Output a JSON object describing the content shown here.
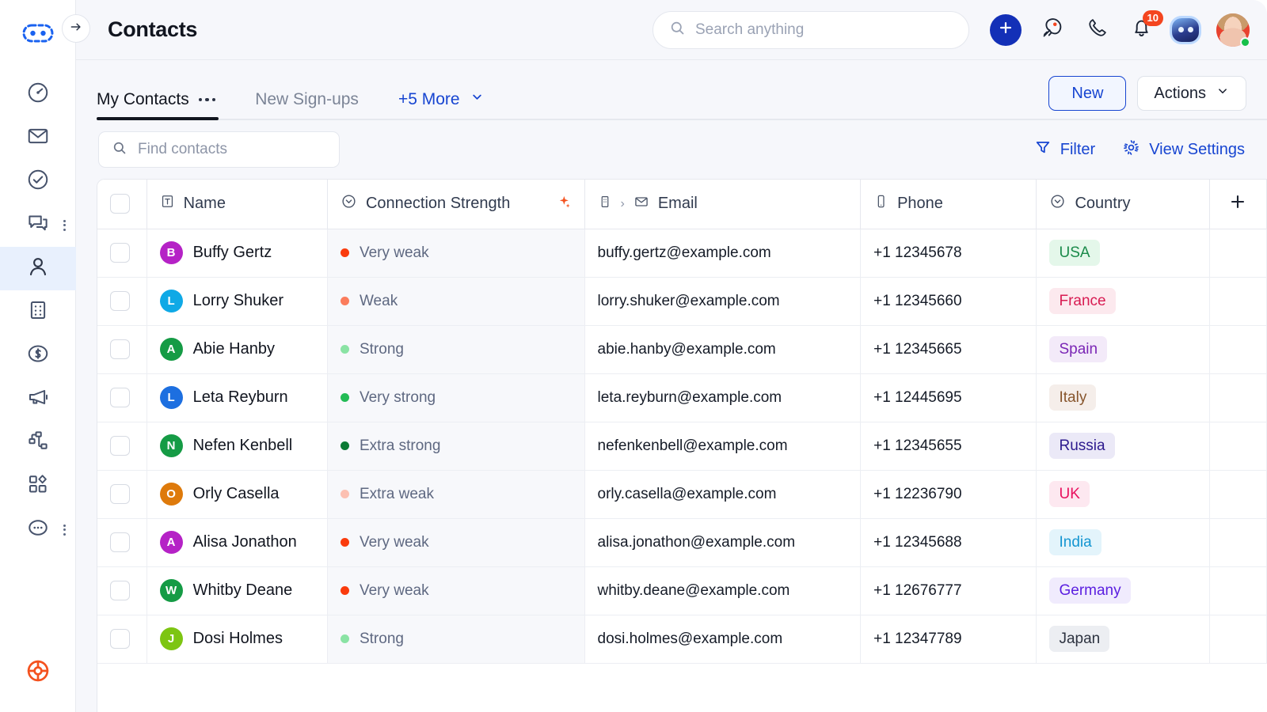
{
  "app": {
    "page_title": "Contacts",
    "collapse_icon": "arrow-right-icon",
    "logo_icon": "brand-logo-icon",
    "help_icon": "life-ring-icon"
  },
  "sidebar": {
    "items": [
      {
        "name": "dashboard",
        "icon": "gauge-icon",
        "active": false,
        "kebab": false
      },
      {
        "name": "mail",
        "icon": "envelope-icon",
        "active": false,
        "kebab": false
      },
      {
        "name": "tasks",
        "icon": "check-circle-icon",
        "active": false,
        "kebab": false
      },
      {
        "name": "chats",
        "icon": "chat-bubbles-icon",
        "active": false,
        "kebab": true
      },
      {
        "name": "contacts",
        "icon": "person-icon",
        "active": true,
        "kebab": false
      },
      {
        "name": "companies",
        "icon": "building-icon",
        "active": false,
        "kebab": false
      },
      {
        "name": "deals",
        "icon": "dollar-circle-icon",
        "active": false,
        "kebab": false
      },
      {
        "name": "marketing",
        "icon": "megaphone-icon",
        "active": false,
        "kebab": false
      },
      {
        "name": "workflows",
        "icon": "org-chart-icon",
        "active": false,
        "kebab": false
      },
      {
        "name": "apps",
        "icon": "apps-grid-icon",
        "active": false,
        "kebab": false
      },
      {
        "name": "more",
        "icon": "more-circle-icon",
        "active": false,
        "kebab": true
      }
    ]
  },
  "search": {
    "placeholder": "Search anything",
    "icon": "search-icon"
  },
  "topbar": {
    "add_label": "+",
    "add_icon": "plus-icon",
    "rocket_icon": "rocket-icon",
    "phone_icon": "phone-icon",
    "bell_icon": "bell-icon",
    "notification_count": "10",
    "bot_icon": "bot-icon",
    "avatar_icon": "user-avatar",
    "status": "online"
  },
  "tabs": {
    "items": [
      {
        "label": "My Contacts",
        "active": true,
        "has_dots": true
      },
      {
        "label": "New Sign-ups",
        "active": false,
        "has_dots": false
      }
    ],
    "more_label": "+5 More",
    "more_icon": "chevron-down-icon",
    "new_button": "New",
    "actions_button": "Actions",
    "actions_icon": "chevron-down-icon"
  },
  "toolbar": {
    "find_placeholder": "Find contacts",
    "find_icon": "search-icon",
    "filter_label": "Filter",
    "filter_icon": "funnel-icon",
    "view_settings_label": "View Settings",
    "view_settings_icon": "gear-icon"
  },
  "table": {
    "columns": [
      {
        "key": "check",
        "label": "",
        "icon": "checkbox-icon"
      },
      {
        "key": "name",
        "label": "Name",
        "icon": "text-type-icon"
      },
      {
        "key": "connection",
        "label": "Connection Strength",
        "icon": "chevron-down-circle-icon",
        "trailing_icon": "sparkle-icon"
      },
      {
        "key": "email",
        "label": "Email",
        "icon": "building-small-icon",
        "sub_icon": "envelope-small-icon",
        "separator": "›"
      },
      {
        "key": "phone",
        "label": "Phone",
        "icon": "mobile-icon"
      },
      {
        "key": "country",
        "label": "Country",
        "icon": "chevron-down-circle-icon"
      },
      {
        "key": "add",
        "label": "",
        "icon": "plus-icon"
      }
    ],
    "rows": [
      {
        "initial": "B",
        "avatar_color": "#b522c6",
        "name": "Buffy Gertz",
        "strength": "Very weak",
        "strength_color": "#fa3b0d",
        "email": "buffy.gertz@example.com",
        "phone": "+1 12345678",
        "country": "USA",
        "country_fg": "#1a8a4a",
        "country_bg": "#e4f7ea"
      },
      {
        "initial": "L",
        "avatar_color": "#0fa9e6",
        "name": "Lorry Shuker",
        "strength": "Weak",
        "strength_color": "#fb7c5c",
        "email": "lorry.shuker@example.com",
        "phone": "+1 12345660",
        "country": "France",
        "country_fg": "#d81b52",
        "country_bg": "#fce9ee"
      },
      {
        "initial": "A",
        "avatar_color": "#159b45",
        "name": "Abie Hanby",
        "strength": "Strong",
        "strength_color": "#8ae3a4",
        "email": "abie.hanby@example.com",
        "phone": "+1 12345665",
        "country": "Spain",
        "country_fg": "#7a25b5",
        "country_bg": "#f3eaf9"
      },
      {
        "initial": "L",
        "avatar_color": "#1d6fe0",
        "name": "Leta Reyburn",
        "strength": "Very strong",
        "strength_color": "#23bb55",
        "email": "leta.reyburn@example.com",
        "phone": "+1 12445695",
        "country": "Italy",
        "country_fg": "#87552c",
        "country_bg": "#f5eeea"
      },
      {
        "initial": "N",
        "avatar_color": "#159b45",
        "name": "Nefen Kenbell",
        "strength": "Extra strong",
        "strength_color": "#0b7a34",
        "email": "nefenkenbell@example.com",
        "phone": "+1 12345655",
        "country": "Russia",
        "country_fg": "#2d1a8e",
        "country_bg": "#ebe9f7"
      },
      {
        "initial": "O",
        "avatar_color": "#de7a0b",
        "name": "Orly Casella",
        "strength": "Extra weak",
        "strength_color": "#fcc0b2",
        "email": "orly.casella@example.com",
        "phone": "+1 12236790",
        "country": "UK",
        "country_fg": "#e8105e",
        "country_bg": "#fde8f0"
      },
      {
        "initial": "A",
        "avatar_color": "#b522c6",
        "name": "Alisa Jonathon",
        "strength": "Very weak",
        "strength_color": "#fa3b0d",
        "email": "alisa.jonathon@example.com",
        "phone": "+1 12345688",
        "country": "India",
        "country_fg": "#1596d1",
        "country_bg": "#e3f4fb"
      },
      {
        "initial": "W",
        "avatar_color": "#159b45",
        "name": "Whitby Deane",
        "strength": "Very weak",
        "strength_color": "#fa3b0d",
        "email": "whitby.deane@example.com",
        "phone": "+1 12676777",
        "country": "Germany",
        "country_fg": "#5b1fe0",
        "country_bg": "#f0ebfd"
      },
      {
        "initial": "J",
        "avatar_color": "#7dc512",
        "name": "Dosi Holmes",
        "strength": "Strong",
        "strength_color": "#8ae3a4",
        "email": "dosi.holmes@example.com",
        "phone": "+1 12347789",
        "country": "Japan",
        "country_fg": "#2d3340",
        "country_bg": "#eceef2"
      }
    ]
  },
  "colors": {
    "accent_blue": "#1745d1",
    "primary_blue": "#1330b7",
    "badge_red": "#f4451f",
    "sparkle_orange": "#f4521f",
    "help_orange": "#f4521f"
  }
}
